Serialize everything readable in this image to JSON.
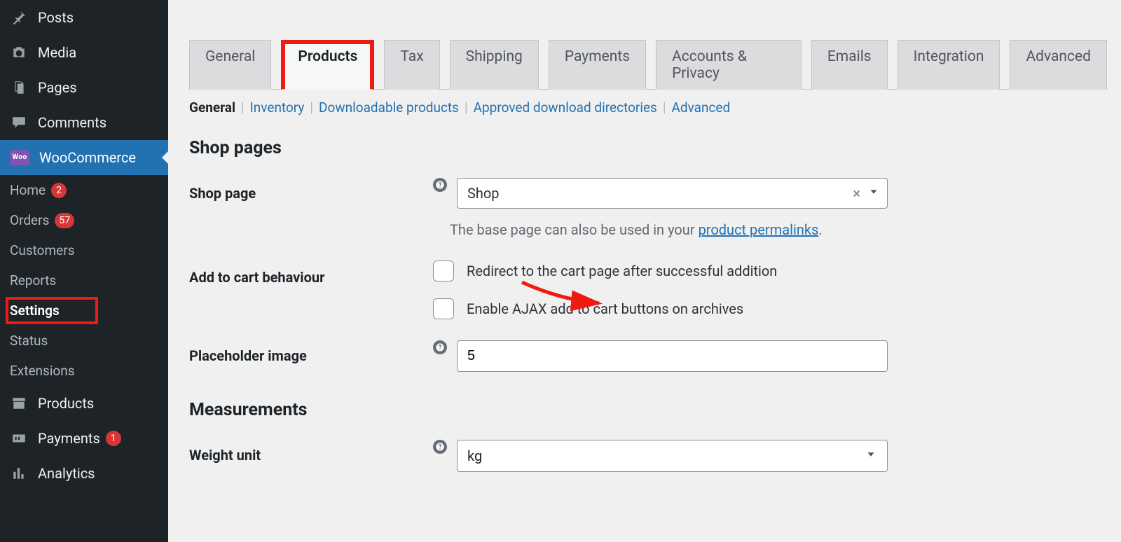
{
  "sidebar": {
    "posts": "Posts",
    "media": "Media",
    "pages": "Pages",
    "comments": "Comments",
    "woocommerce": "WooCommerce",
    "wc_icon_text": "Woo",
    "sub": {
      "home": {
        "label": "Home",
        "badge": "2"
      },
      "orders": {
        "label": "Orders",
        "badge": "57"
      },
      "customers": {
        "label": "Customers"
      },
      "reports": {
        "label": "Reports"
      },
      "settings": {
        "label": "Settings"
      },
      "status": {
        "label": "Status"
      },
      "extensions": {
        "label": "Extensions"
      }
    },
    "products": "Products",
    "payments": {
      "label": "Payments",
      "badge": "1"
    },
    "analytics": "Analytics"
  },
  "tabs": {
    "general": "General",
    "products": "Products",
    "tax": "Tax",
    "shipping": "Shipping",
    "payments": "Payments",
    "accounts": "Accounts & Privacy",
    "emails": "Emails",
    "integration": "Integration",
    "advanced": "Advanced"
  },
  "subtabs": {
    "general": "General",
    "inventory": "Inventory",
    "downloadable": "Downloadable products",
    "approved": "Approved download directories",
    "advanced": "Advanced"
  },
  "sections": {
    "shop_pages": "Shop pages",
    "measurements": "Measurements"
  },
  "fields": {
    "shop_page": {
      "label": "Shop page",
      "value": "Shop",
      "hint_prefix": "The base page can also be used in your ",
      "hint_link": "product permalinks",
      "hint_suffix": "."
    },
    "add_to_cart": {
      "label": "Add to cart behaviour",
      "opt1": "Redirect to the cart page after successful addition",
      "opt2": "Enable AJAX add to cart buttons on archives"
    },
    "placeholder_image": {
      "label": "Placeholder image",
      "value": "5"
    },
    "weight_unit": {
      "label": "Weight unit",
      "value": "kg"
    }
  }
}
